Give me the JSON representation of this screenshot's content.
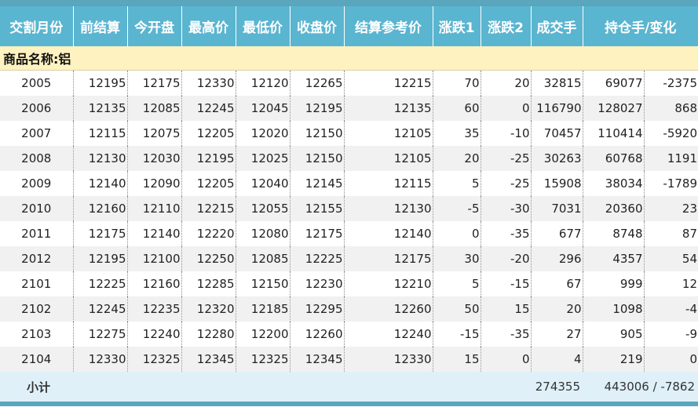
{
  "headers": [
    "交割月份",
    "前结算",
    "今开盘",
    "最高价",
    "最低价",
    "收盘价",
    "结算参考价",
    "涨跌1",
    "涨跌2",
    "成交手",
    "持仓手/变化"
  ],
  "section_label": "商品名称:铝",
  "rows": [
    [
      "2005",
      "12195",
      "12175",
      "12330",
      "12120",
      "12265",
      "12215",
      "70",
      "20",
      "32815",
      "69077",
      "-2375"
    ],
    [
      "2006",
      "12135",
      "12085",
      "12245",
      "12045",
      "12195",
      "12135",
      "60",
      "0",
      "116790",
      "128027",
      "868"
    ],
    [
      "2007",
      "12115",
      "12075",
      "12205",
      "12020",
      "12150",
      "12105",
      "35",
      "-10",
      "70457",
      "110414",
      "-5920"
    ],
    [
      "2008",
      "12130",
      "12030",
      "12195",
      "12025",
      "12150",
      "12105",
      "20",
      "-25",
      "30263",
      "60768",
      "1191"
    ],
    [
      "2009",
      "12140",
      "12090",
      "12205",
      "12040",
      "12145",
      "12115",
      "5",
      "-25",
      "15908",
      "38034",
      "-1789"
    ],
    [
      "2010",
      "12160",
      "12110",
      "12215",
      "12055",
      "12155",
      "12130",
      "-5",
      "-30",
      "7031",
      "20360",
      "23"
    ],
    [
      "2011",
      "12175",
      "12140",
      "12220",
      "12080",
      "12175",
      "12140",
      "0",
      "-35",
      "677",
      "8748",
      "87"
    ],
    [
      "2012",
      "12195",
      "12100",
      "12250",
      "12085",
      "12225",
      "12175",
      "30",
      "-20",
      "296",
      "4357",
      "54"
    ],
    [
      "2101",
      "12225",
      "12160",
      "12285",
      "12150",
      "12230",
      "12210",
      "5",
      "-15",
      "67",
      "999",
      "12"
    ],
    [
      "2102",
      "12245",
      "12235",
      "12320",
      "12185",
      "12295",
      "12260",
      "50",
      "15",
      "20",
      "1098",
      "-4"
    ],
    [
      "2103",
      "12275",
      "12240",
      "12280",
      "12200",
      "12260",
      "12240",
      "-15",
      "-35",
      "27",
      "905",
      "-9"
    ],
    [
      "2104",
      "12330",
      "12325",
      "12345",
      "12325",
      "12345",
      "12330",
      "15",
      "0",
      "4",
      "219",
      "0"
    ]
  ],
  "subtotal": {
    "label": "小计",
    "volume": "274355",
    "open_interest": "443006 / -7862"
  }
}
